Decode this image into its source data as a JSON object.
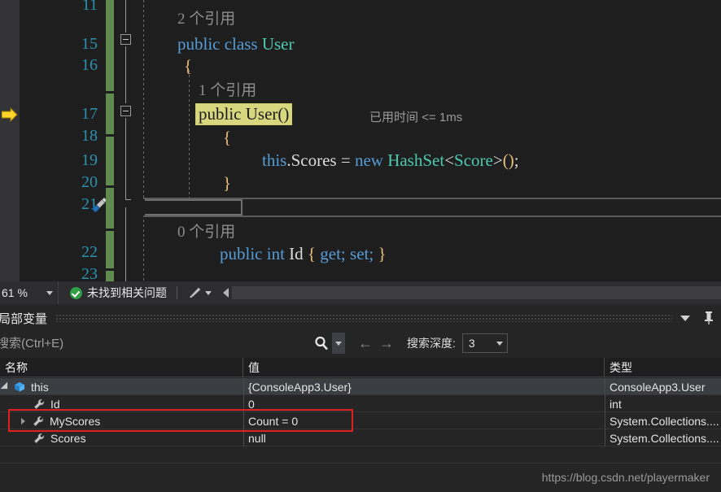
{
  "editor": {
    "line_numbers": [
      "11",
      "15",
      "16",
      "17",
      "18",
      "19",
      "20",
      "21",
      "22",
      "23"
    ],
    "codelens": [
      {
        "text": "2 个引用"
      },
      {
        "text": "1 个引用"
      },
      {
        "text": "0 个引用"
      }
    ],
    "lines": {
      "class_decl_kw": "public class ",
      "class_decl_name": "User",
      "open_brace": "{",
      "ctor_highlight": "public User()",
      "ctor_open_brace": "{",
      "body_this": "this",
      "body_dot": ".",
      "body_scores": "Scores",
      "body_eq": " = ",
      "body_new": "new ",
      "body_hashset": "HashSet",
      "body_lt": "<",
      "body_score": "Score",
      "body_gt": ">",
      "body_parens": "()",
      "body_semi": ";",
      "ctor_close_brace": "}",
      "prop_public": "public ",
      "prop_int": "int ",
      "prop_id": "Id ",
      "prop_accessors_open": "{ ",
      "prop_get": "get;",
      "prop_set": " set;",
      "prop_accessors_close": " }"
    },
    "elapsed_time": "已用时间 <= 1ms",
    "icons": {
      "step_arrow": "step-arrow-icon",
      "quick_action": "screwdriver-icon",
      "outline_collapse": "outline-collapse-icon"
    }
  },
  "statusbar": {
    "zoom_level": "61 %",
    "problem_status": "未找到相关问题",
    "icons": {
      "ok": "check-circle-icon",
      "brush": "brush-icon",
      "zoom_caret": "chevron-down-icon",
      "scroll_left": "scroll-left-arrow-icon"
    }
  },
  "panel": {
    "title": "局部变量",
    "search": {
      "placeholder": "搜索(Ctrl+E)",
      "value": ""
    },
    "depth_label": "搜索深度:",
    "depth_value": "3",
    "icons": {
      "search": "magnifier-icon",
      "search_dropdown": "chevron-down-icon",
      "prev": "arrow-left-icon",
      "next": "arrow-right-icon",
      "panel_menu": "chevron-down-icon",
      "pin": "pin-icon"
    },
    "grid": {
      "columns": [
        "名称",
        "值",
        "类型"
      ],
      "rows": [
        {
          "name": "this",
          "value": "{ConsoleApp3.User}",
          "type": "ConsoleApp3.User",
          "expander": "expanded",
          "icon": "object-cube-icon",
          "indent": 0,
          "selected": true,
          "highlighted": false
        },
        {
          "name": "Id",
          "value": "0",
          "type": "int",
          "expander": "none",
          "icon": "property-wrench-icon",
          "indent": 1,
          "selected": false,
          "highlighted": false
        },
        {
          "name": "MyScores",
          "value": "Count = 0",
          "type": "System.Collections....",
          "expander": "collapsed",
          "icon": "property-wrench-icon",
          "indent": 1,
          "selected": false,
          "highlighted": true
        },
        {
          "name": "Scores",
          "value": "null",
          "type": "System.Collections....",
          "expander": "none",
          "icon": "property-wrench-icon",
          "indent": 1,
          "selected": false,
          "highlighted": false
        }
      ]
    }
  },
  "watermark": "https://blog.csdn.net/playermaker",
  "colors": {
    "accent_highlight": "#d7d77f",
    "red_annotation": "#e02020",
    "keyword": "#569cd6",
    "type": "#4ec9b0",
    "linenumber": "#2b91af",
    "changebar": "#608b4e"
  }
}
